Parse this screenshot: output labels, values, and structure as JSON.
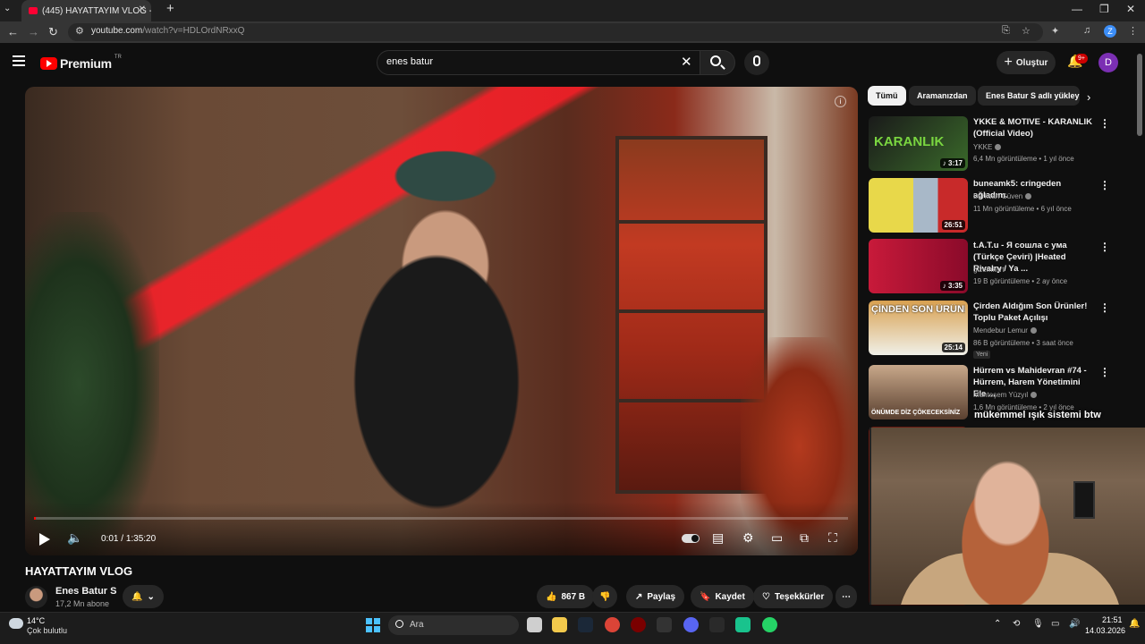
{
  "browser": {
    "tab_title": "(445) HAYATTAYIM VLOG - YouTube",
    "url_host": "youtube.com",
    "url_path": "/watch?v=HDLOrdNRxxQ",
    "profile_initial": "Z"
  },
  "header": {
    "logo_text": "Premium",
    "country_code": "TR",
    "search_value": "enes batur",
    "create_label": "Oluştur",
    "notifications_badge": "9+",
    "avatar_initial": "D"
  },
  "player": {
    "time_current": "0:01",
    "time_separator": " / ",
    "time_total": "1:35:20",
    "progress_fraction": 0.0002
  },
  "video": {
    "title": "HAYATTAYIM VLOG",
    "channel_name": "Enes Batur S",
    "channel_subs": "17,2 Mn abone",
    "like_count": "867 B",
    "share_label": "Paylaş",
    "save_label": "Kaydet",
    "thanks_label": "Teşekkürler"
  },
  "sidebar": {
    "chips": [
      "Tümü",
      "Aramanızdan",
      "Enes Batur S adlı yükley"
    ],
    "recommendations": [
      {
        "title": "YKKE & MOTIVE - KARANLIK (Official Video)",
        "channel": "YKKE",
        "meta": "6,4 Mn görüntüleme • 1 yıl önce",
        "duration": "♪ 3:17",
        "verified": true,
        "thumb_text": "KARANLIK"
      },
      {
        "title": "buneamk5: cringeden ağladım.",
        "channel": "Berkcan Güven",
        "meta": "11 Mn görüntüleme • 6 yıl önce",
        "duration": "26:51",
        "verified": true,
        "thumb_text": ""
      },
      {
        "title": "t.A.T.u - Я сошла с ума (Türkçe Çeviri) |Heated Rivalry / Ya ...",
        "channel": "gizemkurt",
        "meta": "19 B görüntüleme • 2 ay önce",
        "duration": "♪ 3:35",
        "verified": false,
        "thumb_text": ""
      },
      {
        "title": "Çirden Aldığım Son Ürünler! Toplu Paket Açılışı",
        "channel": "Mendebur Lemur",
        "meta": "86 B görüntüleme • 3 saat önce",
        "duration": "25:14",
        "verified": true,
        "new_badge": "Yeni",
        "thumb_text": "ÇİNDEN SON ÜRÜNLER"
      },
      {
        "title": "Hürrem vs Mahidevran #74 - Hürrem, Harem Yönetimini Ele ...",
        "channel": "Muhteşem Yüzyıl",
        "meta": "1,6 Mn görüntüleme • 2 yıl önce",
        "duration": "",
        "verified": true,
        "thumb_text": "ÖNÜMDE DİZ ÇÖKECEKSİNİZ"
      }
    ]
  },
  "overlay": {
    "caption": "mükemmel ışık sistemi btw"
  },
  "taskbar": {
    "temperature": "14°C",
    "weather": "Çok bulutlu",
    "search_placeholder": "Ara",
    "time": "21:51",
    "date": "14.03.2026"
  }
}
